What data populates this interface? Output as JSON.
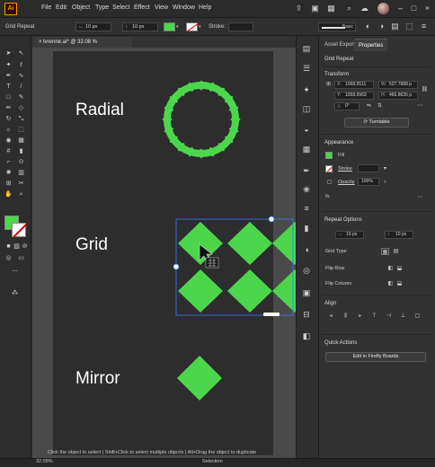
{
  "menubar": {
    "logo": "Ai",
    "items": [
      "File",
      "Edit",
      "Object",
      "Type",
      "Select",
      "Effect",
      "View",
      "Window",
      "Help"
    ]
  },
  "controlbar": {
    "object_type": "Grid Repeat",
    "spacing_h": "10 px",
    "spacing_v": "10 px",
    "stroke_label": "Stroke:",
    "brush_label": "Basic",
    "fill_color": "#4cd64c"
  },
  "document": {
    "tab_title": "tvrenne.ai* @ 32.08 % (RGB/Preview)",
    "close_glyph": "×"
  },
  "artboard": {
    "labels": [
      "Radial",
      "Grid",
      "Mirror"
    ],
    "shape_color": "#4cd64c"
  },
  "panel": {
    "tabs": [
      "Asset Export",
      "Properties"
    ],
    "object_title": "Grid Repeat",
    "transform": {
      "title": "Transform",
      "x_label": "X:",
      "x": "1068.5511",
      "y_label": "Y:",
      "y": "1058.9963",
      "w_label": "W:",
      "w": "527.7688 p",
      "h_label": "H:",
      "h": "466.8635 p",
      "angle": "0°",
      "turntable_button": "Turntable"
    },
    "appearance": {
      "title": "Appearance",
      "fill_label": "Fill",
      "stroke_label": "Stroke",
      "opacity_label": "Opacity",
      "opacity_value": "100%",
      "fx": "fx."
    },
    "repeat_options": {
      "title": "Repeat Options",
      "h_spacing": "10 px",
      "v_spacing": "10 px",
      "grid_type_label": "Grid Type",
      "flip_row_label": "Flip Row",
      "flip_column_label": "Flip Column"
    },
    "align": {
      "title": "Align"
    },
    "quick_actions": {
      "title": "Quick Actions",
      "firefly_button": "Edit in Firefly Boards"
    }
  },
  "statusbar": {
    "zoom": "32.08%",
    "hint": "Click the object to select  |  Shift+Click to select multiple objects  |  Alt+Drag the object to duplicate",
    "mode": "Selection"
  }
}
